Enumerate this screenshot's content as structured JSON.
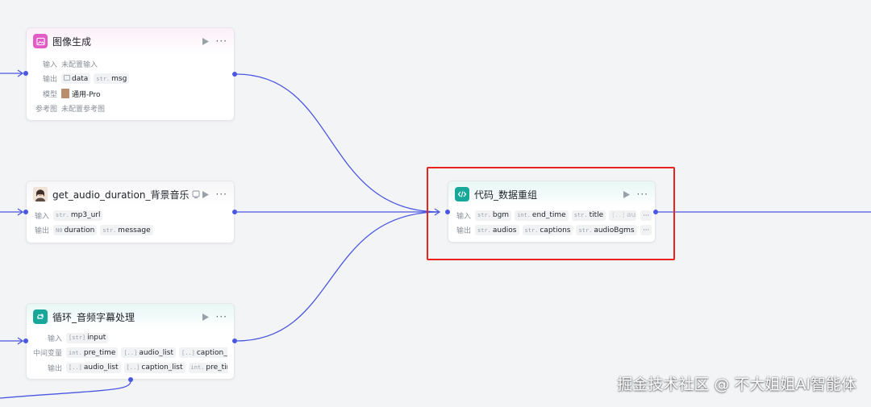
{
  "colors": {
    "wire": "#4a57e0",
    "highlight": "#e8231e",
    "image_icon_bg": "#e25bc7",
    "code_icon_bg": "#17a89a"
  },
  "nodes": {
    "image_gen": {
      "title": "图像生成",
      "icon": "image-icon",
      "input_label": "输入",
      "input_text": "未配置输入",
      "output_label": "输出",
      "outputs": [
        {
          "type": "img",
          "name": "data"
        },
        {
          "type": "str.",
          "name": "msg"
        }
      ],
      "model_label": "模型",
      "model_value": "通用-Pro",
      "ref_label": "参考图",
      "ref_text": "未配置参考图"
    },
    "audio_duration": {
      "title": "get_audio_duration_背景音乐",
      "icon": "avatar-icon",
      "input_label": "输入",
      "inputs": [
        {
          "type": "str.",
          "name": "mp3_url"
        }
      ],
      "output_label": "输出",
      "outputs": [
        {
          "type": "N0",
          "name": "duration"
        },
        {
          "type": "str.",
          "name": "message"
        }
      ]
    },
    "loop": {
      "title": "循环_音频字幕处理",
      "icon": "loop-icon",
      "input_label": "输入",
      "inputs": [
        {
          "type": "[str]",
          "name": "input"
        }
      ],
      "mid_label": "中间变量",
      "mids": [
        {
          "type": "int.",
          "name": "pre_time"
        },
        {
          "type": "[..]",
          "name": "audio_list"
        },
        {
          "type": "[..]",
          "name": "caption_list"
        }
      ],
      "output_label": "输出",
      "outputs": [
        {
          "type": "[..]",
          "name": "audio_list"
        },
        {
          "type": "[..]",
          "name": "caption_list"
        },
        {
          "type": "int.",
          "name": "pre_time"
        }
      ]
    },
    "code": {
      "title": "代码_数据重组",
      "icon": "code-icon",
      "input_label": "输入",
      "inputs": [
        {
          "type": "str.",
          "name": "bgm"
        },
        {
          "type": "int.",
          "name": "end_time"
        },
        {
          "type": "str.",
          "name": "title"
        },
        {
          "type": "[..]",
          "name": "audio"
        }
      ],
      "output_label": "输出",
      "outputs": [
        {
          "type": "str.",
          "name": "audios"
        },
        {
          "type": "str.",
          "name": "captions"
        },
        {
          "type": "str.",
          "name": "audioBgms"
        }
      ],
      "more": "···"
    }
  },
  "watermark": "掘金技术社区 @ 不大姐姐AI智能体"
}
